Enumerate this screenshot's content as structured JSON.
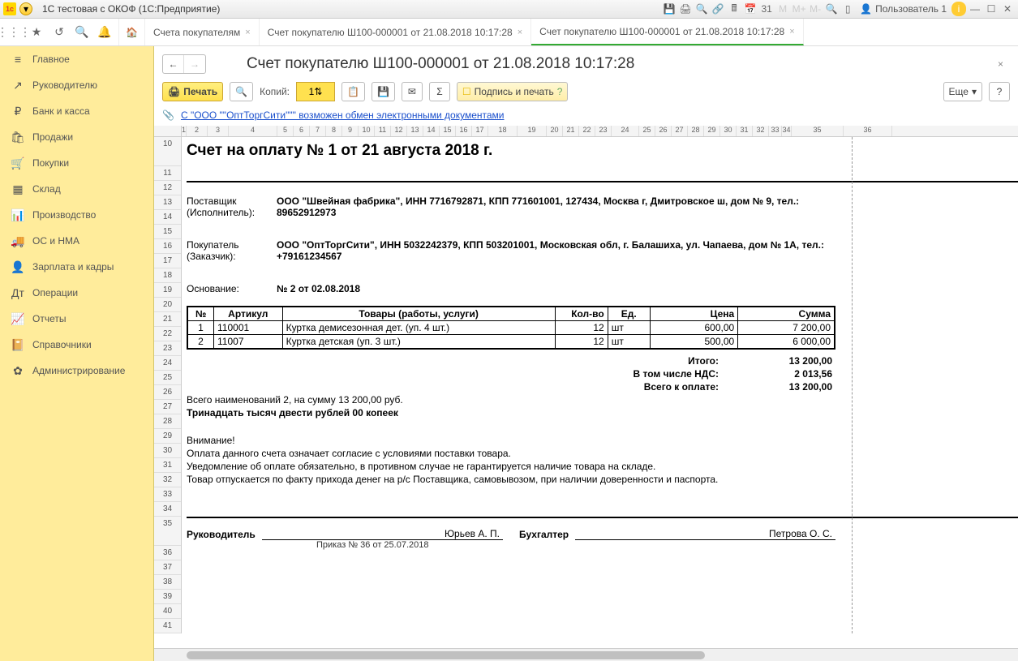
{
  "window_title": "1С тестовая с ОКОФ  (1С:Предприятие)",
  "user": "Пользователь 1",
  "tabs": [
    {
      "label": "Счета покупателям"
    },
    {
      "label": "Счет покупателю Ш100-000001 от 21.08.2018 10:17:28"
    },
    {
      "label": "Счет покупателю Ш100-000001 от 21.08.2018 10:17:28",
      "active": true
    }
  ],
  "sidebar": {
    "items": [
      {
        "icon": "≡",
        "label": "Главное"
      },
      {
        "icon": "↗",
        "label": "Руководителю"
      },
      {
        "icon": "₽",
        "label": "Банк и касса"
      },
      {
        "icon": "🛍",
        "label": "Продажи"
      },
      {
        "icon": "🛒",
        "label": "Покупки"
      },
      {
        "icon": "▦",
        "label": "Склад"
      },
      {
        "icon": "📊",
        "label": "Производство"
      },
      {
        "icon": "🚚",
        "label": "ОС и НМА"
      },
      {
        "icon": "👤",
        "label": "Зарплата и кадры"
      },
      {
        "icon": "Дт",
        "label": "Операции"
      },
      {
        "icon": "📈",
        "label": "Отчеты"
      },
      {
        "icon": "📔",
        "label": "Справочники"
      },
      {
        "icon": "✿",
        "label": "Администрирование"
      }
    ]
  },
  "doc_title": "Счет покупателю Ш100-000001 от 21.08.2018 10:17:28",
  "toolbar": {
    "print": "Печать",
    "copies_label": "Копий:",
    "copies_value": "1",
    "sign_print": "Подпись и печать",
    "more": "Еще"
  },
  "exchange_link": "С \"ООО \"\"ОптТоргСити\"\"\" возможен обмен электронными документами",
  "invoice": {
    "title": "Счет на оплату № 1 от 21 августа 2018 г.",
    "supplier_label": "Поставщик (Исполнитель):",
    "supplier": "ООО \"Швейная фабрика\", ИНН 7716792871, КПП 771601001, 127434, Москва г, Дмитровское ш, дом № 9, тел.: 89652912973",
    "buyer_label": "Покупатель (Заказчик):",
    "buyer": "ООО \"ОптТоргСити\", ИНН 5032242379, КПП 503201001, Московская обл, г. Балашиха, ул. Чапаева, дом № 1А, тел.: +79161234567",
    "basis_label": "Основание:",
    "basis": "№ 2 от 02.08.2018",
    "headers": {
      "num": "№",
      "art": "Артикул",
      "name": "Товары (работы, услуги)",
      "qty": "Кол-во",
      "unit": "Ед.",
      "price": "Цена",
      "sum": "Сумма"
    },
    "items": [
      {
        "num": "1",
        "art": "110001",
        "name": "Куртка демисезонная дет. (уп. 4 шт.)",
        "qty": "12",
        "unit": "шт",
        "price": "600,00",
        "sum": "7 200,00"
      },
      {
        "num": "2",
        "art": "11007",
        "name": "Куртка детская (уп. 3 шт.)",
        "qty": "12",
        "unit": "шт",
        "price": "500,00",
        "sum": "6 000,00"
      }
    ],
    "totals": {
      "itogo_label": "Итого:",
      "itogo": "13 200,00",
      "nds_label": "В том числе НДС:",
      "nds": "2 013,56",
      "total_label": "Всего к оплате:",
      "total": "13 200,00"
    },
    "summary1": "Всего наименований 2, на сумму 13 200,00 руб.",
    "summary2": "Тринадцать тысяч двести рублей 00 копеек",
    "attention": "Внимание!",
    "note1": "Оплата данного счета означает согласие с условиями поставки товара.",
    "note2": "Уведомление об оплате обязательно, в противном случае не гарантируется наличие товара на складе.",
    "note3": "Товар отпускается по факту прихода денег на р/с Поставщика, самовывозом, при наличии доверенности и паспорта.",
    "sig": {
      "director_label": "Руководитель",
      "director": "Юрьев А. П.",
      "accountant_label": "Бухгалтер",
      "accountant": "Петрова О. С.",
      "order": "Приказ № 36 от 25.07.2018"
    }
  }
}
